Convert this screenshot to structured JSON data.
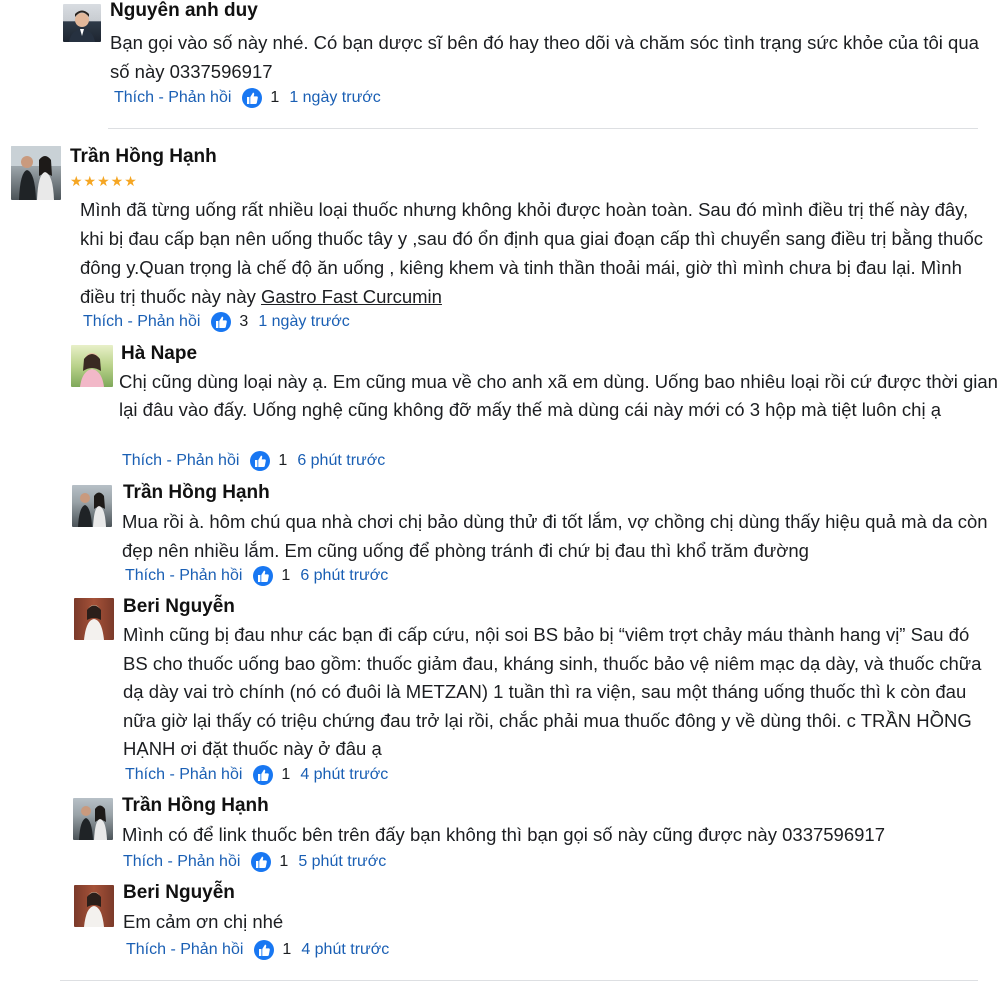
{
  "action_label": "Thích - Phản hồi",
  "comments": [
    {
      "name": "Nguyên anh duy",
      "text": "Bạn gọi vào số này nhé. Có bạn dược sĩ bên đó hay theo dõi và chăm sóc tình trạng sức khỏe của tôi qua số này 0337596917",
      "likes": "1",
      "time": "1 ngày trước"
    },
    {
      "name": "Trần Hồng Hạnh",
      "stars": "★★★★★",
      "rating": 5,
      "text": "Mình đã từng uống rất nhiều loại thuốc nhưng không khỏi được hoàn toàn. Sau đó mình điều trị thế này đây, khi bị đau cấp bạn nên uống thuốc tây y ,sau đó ổn định qua giai đoạn cấp thì chuyển sang điều trị bằng thuốc đông y.Quan trọng là chế độ ăn uống , kiêng khem và tinh thần thoải mái, giờ thì mình chưa bị đau lại. Mình điều trị thuốc này này",
      "product_link": "Gastro Fast Curcumin",
      "likes": "3",
      "time": "1 ngày trước"
    }
  ],
  "replies": [
    {
      "name": "Hà Nape",
      "text": "Chị cũng dùng loại này ạ. Em cũng mua về cho anh xã em dùng. Uống bao nhiêu loại rồi cứ được thời gian lại đâu vào đấy. Uống nghệ cũng không đỡ mấy thế mà dùng cái này mới có 3 hộp mà tiệt luôn chị ạ",
      "likes": "1",
      "time": "6 phút trước"
    },
    {
      "name": "Trần Hồng Hạnh",
      "text": "Mua rồi à. hôm chú qua nhà chơi chị bảo dùng thử đi tốt lắm, vợ chồng chị dùng thấy hiệu quả mà da còn đẹp nên nhiều lắm. Em cũng uống để phòng tránh đi chứ bị đau thì khổ trăm đường",
      "likes": "1",
      "time": "6 phút trước"
    },
    {
      "name": "Beri Nguyễn",
      "text": "Mình cũng bị đau như các bạn đi cấp cứu, nội soi BS bảo bị “viêm trợt chảy máu thành hang vị” Sau đó BS cho thuốc uống bao gồm: thuốc giảm đau, kháng sinh, thuốc bảo vệ niêm mạc dạ dày, và thuốc chữa dạ dày vai trò chính (nó có đuôi là METZAN) 1 tuần thì ra viện, sau một tháng uống thuốc thì k còn đau nữa giờ lại thấy có triệu chứng đau trở lại rồi, chắc phải mua thuốc đông y về dùng thôi. c TRẦN HỒNG HẠNH ơi đặt thuốc này ở đâu ạ",
      "likes": "1",
      "time": "4 phút trước"
    },
    {
      "name": "Trần Hồng Hạnh",
      "text": "Mình có để link thuốc bên trên đấy bạn không thì bạn gọi số này cũng được này 0337596917",
      "likes": "1",
      "time": "5 phút trước"
    },
    {
      "name": "Beri Nguyễn",
      "text": "Em cảm ơn chị nhé",
      "likes": "1",
      "time": "4 phút trước"
    }
  ],
  "colors": {
    "link": "#1a5fb4",
    "like_badge": "#1877f2",
    "star": "#f5a623",
    "divider": "#dddfe2"
  }
}
